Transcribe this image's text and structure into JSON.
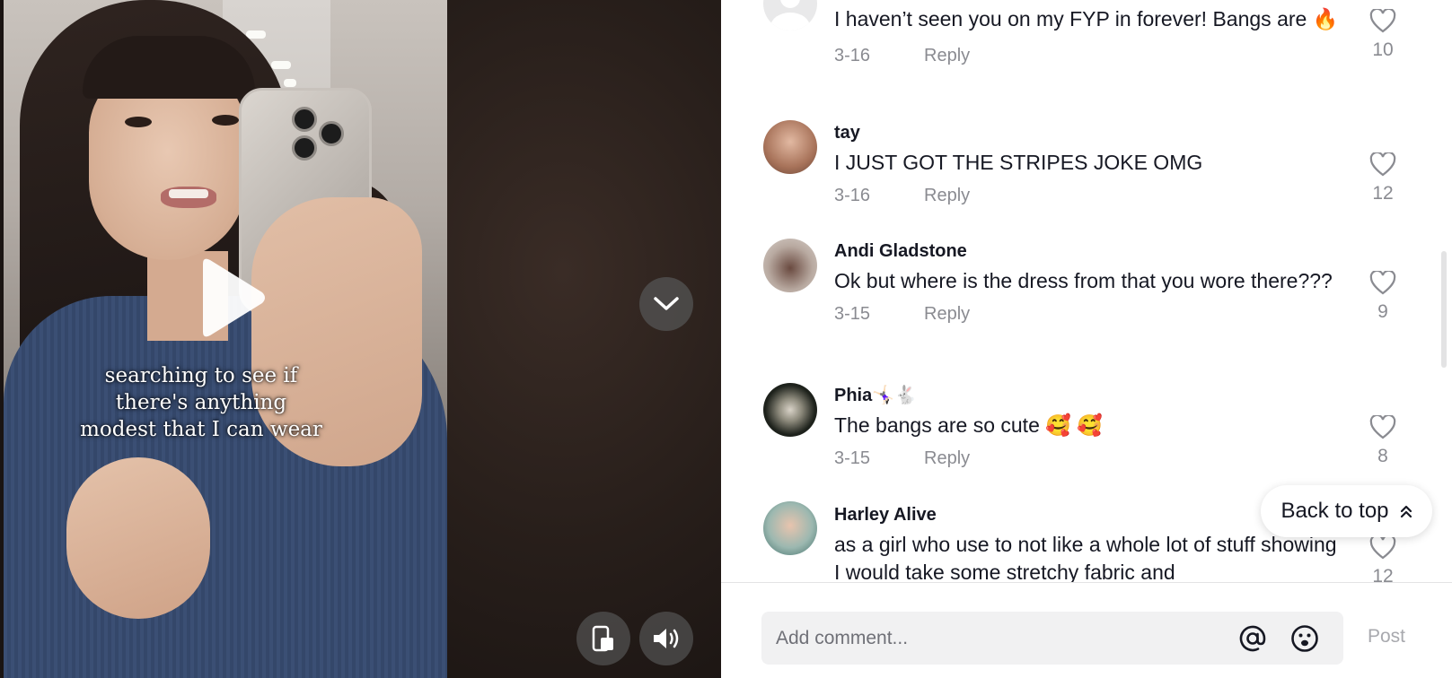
{
  "video": {
    "caption": "searching to see if there's anything modest that I can wear",
    "controls": {
      "play_icon": "play-icon",
      "scroll_down_icon": "chevron-down-icon",
      "miniplayer_icon": "floating-player-icon",
      "volume_icon": "volume-icon"
    }
  },
  "comments": [
    {
      "user": "",
      "text": "I haven’t seen you on my FYP in forever! Bangs are 🔥",
      "date": "3-16",
      "reply": "Reply",
      "likes": "10"
    },
    {
      "user": "tay",
      "text": "I JUST GOT THE STRIPES JOKE OMG",
      "date": "3-16",
      "reply": "Reply",
      "likes": "12"
    },
    {
      "user": "Andi Gladstone",
      "text": "Ok but where is the dress from that you wore there???",
      "date": "3-15",
      "reply": "Reply",
      "likes": "9"
    },
    {
      "user": "Phia🤸🏻‍♀️🐇",
      "text": "The bangs are so cute 🥰 🥰",
      "date": "3-15",
      "reply": "Reply",
      "likes": "8"
    },
    {
      "user": "Harley Alive",
      "text": "as a girl who use to not like a whole lot of stuff showing I would take some stretchy fabric and",
      "date": "",
      "reply": "",
      "likes": "12"
    }
  ],
  "back_to_top": {
    "label": "Back to top",
    "icon": "double-chevron-up-icon"
  },
  "composer": {
    "placeholder": "Add comment...",
    "mention_icon": "at-sign-icon",
    "emoji_icon": "emoji-icon",
    "post_label": "Post"
  },
  "colors": {
    "text": "#161823",
    "muted": "#8a8b91",
    "input_bg": "#f1f1f2"
  }
}
